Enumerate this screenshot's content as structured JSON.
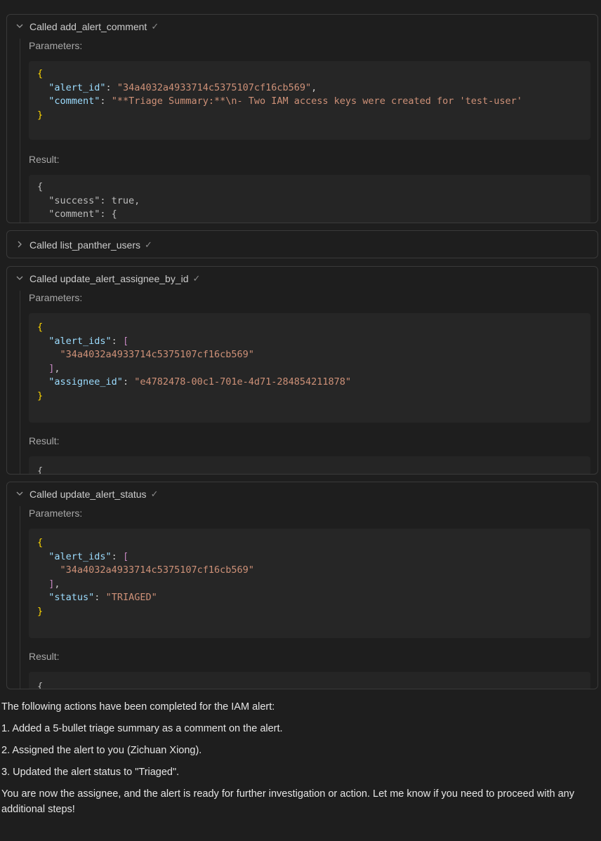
{
  "calls": [
    {
      "title": "Called add_alert_comment",
      "expanded": true,
      "parameters_label": "Parameters:",
      "params": {
        "alert_id_key": "\"alert_id\"",
        "alert_id_val": "\"34a4032a4933714c5375107cf16cb569\"",
        "comment_key": "\"comment\"",
        "comment_val": "\"**Triage Summary:**\\n- Two IAM access keys were created for 'test-user'"
      },
      "result_label": "Result:",
      "result_lines": [
        "{",
        "  \"success\": true,",
        "  \"comment\": {"
      ]
    },
    {
      "title": "Called list_panther_users",
      "expanded": false
    },
    {
      "title": "Called update_alert_assignee_by_id",
      "expanded": true,
      "parameters_label": "Parameters:",
      "params": {
        "alert_ids_key": "\"alert_ids\"",
        "alert_id_item": "\"34a4032a4933714c5375107cf16cb569\"",
        "assignee_key": "\"assignee_id\"",
        "assignee_val": "\"e4782478-00c1-701e-4d71-284854211878\""
      },
      "result_label": "Result:",
      "result_lines": [
        "{"
      ]
    },
    {
      "title": "Called update_alert_status",
      "expanded": true,
      "parameters_label": "Parameters:",
      "params": {
        "alert_ids_key": "\"alert_ids\"",
        "alert_id_item": "\"34a4032a4933714c5375107cf16cb569\"",
        "status_key": "\"status\"",
        "status_val": "\"TRIAGED\""
      },
      "result_label": "Result:",
      "result_lines": [
        "{"
      ]
    }
  ],
  "message": {
    "intro": "The following actions have been completed for the IAM alert:",
    "items": [
      "1. Added a 5-bullet triage summary as a comment on the alert.",
      "2. Assigned the alert to you (Zichuan Xiong).",
      "3. Updated the alert status to \"Triaged\"."
    ],
    "closing": "You are now the assignee, and the alert is ready for further investigation or action. Let me know if you need to proceed with any additional steps!"
  },
  "icons": {
    "expanded": "chevron-down-icon",
    "collapsed": "chevron-right-icon",
    "success": "check-icon"
  },
  "colors": {
    "background": "#1e1e1e",
    "code_bg": "#262626",
    "json_key": "#9cdcfe",
    "json_string": "#ce9178",
    "json_bracket": "#c586c0",
    "json_brace": "#ffd700"
  }
}
